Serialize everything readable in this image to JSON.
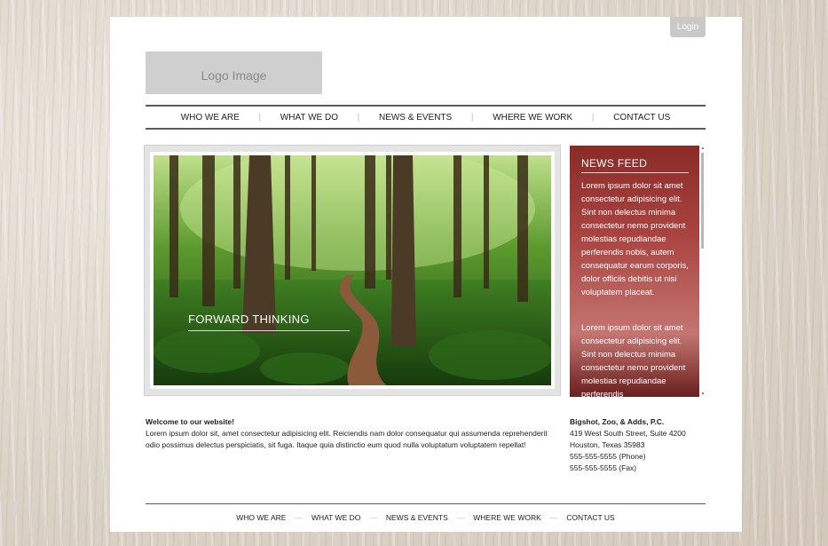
{
  "header": {
    "login_label": "Login",
    "logo_text": "Logo Image"
  },
  "topnav": {
    "items": [
      {
        "label": "WHO WE ARE"
      },
      {
        "label": "WHAT WE DO"
      },
      {
        "label": "NEWS & EVENTS"
      },
      {
        "label": "WHERE WE WORK"
      },
      {
        "label": "CONTACT US"
      }
    ],
    "separator": "|"
  },
  "hero": {
    "caption": "FORWARD THINKING"
  },
  "news_feed": {
    "title": "NEWS FEED",
    "paragraphs": [
      "Lorem ipsum dolor sit amet consectetur adipisicing elit. Sint non delectus minima consectetur nemo provident molestias repudiandae perferendis nobis, autem consequatur earum corporis, dolor officiis debitis ut nisi voluptatem placeat.",
      "Lorem ipsum dolor sit amet consectetur adipisicing elit. Sint non delectus minima consectetur nemo provident molestias repudiandae perferendis"
    ]
  },
  "welcome": {
    "title": "Welcome to our website!",
    "body": "Lorem ipsum dolor sit, amet consectetur adipisicing elit. Reiciendis nam dolor consequatur qui assumenda reprehenderit odio possimus delectus perspiciatis, sit fuga. Itaque quia distinctio eum quod nulla voluptatum voluptatem repellat!"
  },
  "address": {
    "company": "Bigshot, Zoo, & Adds, P.C.",
    "street": "419 West South Street, Suite 4200",
    "city": "Houston, Texas 35983",
    "phone": "555-555-5555 (Phone)",
    "fax": "555-555-5555 (Fax)"
  },
  "footer": {
    "items": [
      {
        "label": "WHO WE ARE"
      },
      {
        "label": "WHAT WE DO"
      },
      {
        "label": "NEWS & EVENTS"
      },
      {
        "label": "WHERE WE WORK"
      },
      {
        "label": "CONTACT US"
      }
    ],
    "separator": "—"
  },
  "colors": {
    "news_panel": "#a94340",
    "nav_border": "#5a5a5a",
    "logo_bg": "#cfcfcf"
  }
}
